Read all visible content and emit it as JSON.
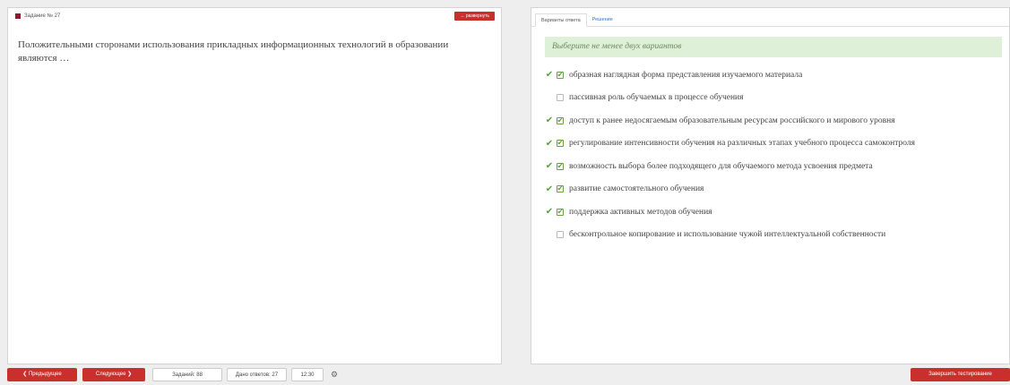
{
  "task": {
    "header": "Задание № 27",
    "expand_label": "↔ развернуть",
    "question": "Положительными сторонами использования прикладных информационных технологий в образовании являются …"
  },
  "tabs": {
    "answers": "Варианты ответа",
    "solution": "Решение"
  },
  "hint": "Выберите не менее двух вариантов",
  "options": [
    {
      "text": "образная наглядная форма представления изучаемого материала",
      "checked": true
    },
    {
      "text": "пассивная роль обучаемых в процессе обучения",
      "checked": false
    },
    {
      "text": "доступ к ранее недосягаемым образовательным ресурсам российского и мирового уровня",
      "checked": true
    },
    {
      "text": "регулирование интенсивности обучения на различных этапах учебного процесса самоконтроля",
      "checked": true
    },
    {
      "text": "возможность выбора более подходящего для обучаемого метода усвоения предмета",
      "checked": true
    },
    {
      "text": "развитие самостоятельного обучения",
      "checked": true
    },
    {
      "text": "поддержка активных методов обучения",
      "checked": true
    },
    {
      "text": "бесконтрольное копирование и использование чужой интеллектуальной собственности",
      "checked": false
    }
  ],
  "footer": {
    "prev": "❮ Предыдущее",
    "next": "Следующее ❯",
    "tasks": "Заданий: 88",
    "answers": "Дано ответов: 27",
    "timer": "12:30",
    "finish": "Завершить тестирование"
  },
  "colors": {
    "accent": "#c9302c",
    "check": "#5aa03d",
    "hint_bg": "#dff0d8"
  }
}
